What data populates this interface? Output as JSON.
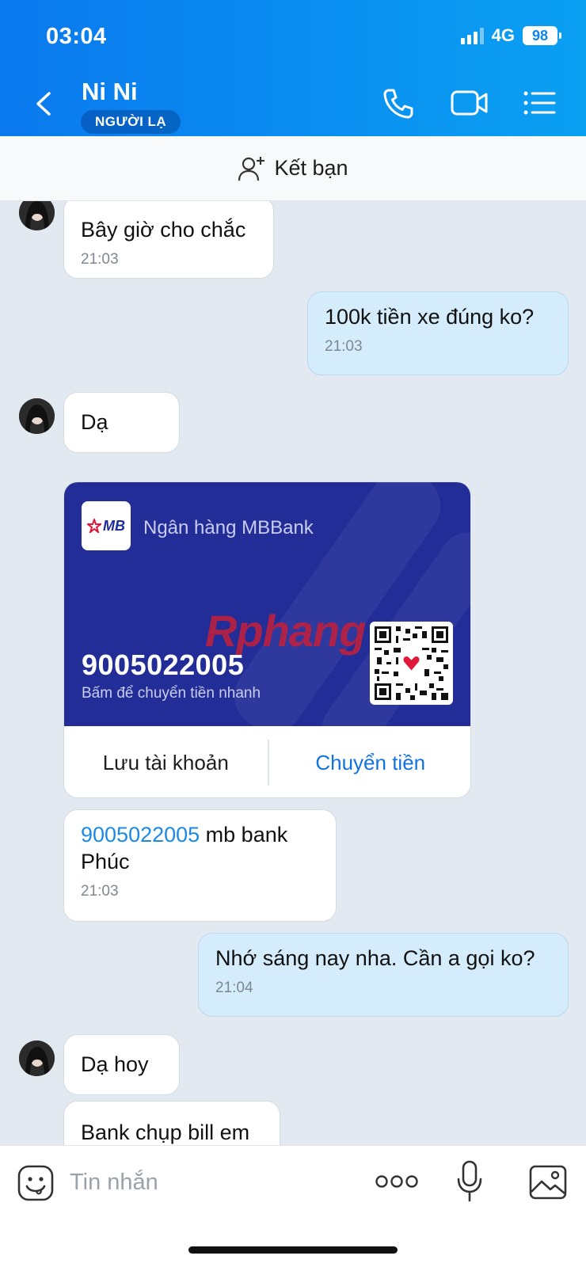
{
  "status_bar": {
    "time": "03:04",
    "network": "4G",
    "battery": "98"
  },
  "header": {
    "contact_name": "Ni Ni",
    "badge": "NGƯỜI LẠ"
  },
  "add_friend": {
    "label": "Kết bạn"
  },
  "messages": [
    {
      "side": "them",
      "text": "Bây giờ cho chắc",
      "time": "21:03"
    },
    {
      "side": "me",
      "text": "100k tiền xe đúng ko?",
      "time": "21:03"
    },
    {
      "side": "them",
      "text": "Dạ",
      "time": ""
    },
    {
      "side": "them",
      "text_link": "9005022005",
      "text_rest": " mb bank Phúc",
      "time": "21:03"
    },
    {
      "side": "me",
      "text": "Nhớ sáng nay nha. Cần a gọi ko?",
      "time": "21:04"
    },
    {
      "side": "them",
      "text": "Dạ hoy",
      "time": ""
    },
    {
      "side": "them",
      "text": "Bank chụp bill em",
      "time": ""
    }
  ],
  "bank_card": {
    "logo_text": "MB",
    "bank_name": "Ngân hàng MBBank",
    "watermark": "Rphang",
    "account_number": "9005022005",
    "hint": "Bấm để chuyển tiền nhanh",
    "save_label": "Lưu tài khoản",
    "transfer_label": "Chuyển tiền",
    "bg_color": "#232d97"
  },
  "composer": {
    "placeholder": "Tin nhắn"
  },
  "colors": {
    "header": "#0a86ef",
    "my_bubble": "#d4ecfb",
    "link": "#1b8ae5",
    "chat_bg": "#e2e9f1"
  },
  "icons": [
    "back-icon",
    "phone-icon",
    "video-call-icon",
    "menu-list-icon",
    "add-person-icon",
    "emoji-icon",
    "more-icon",
    "microphone-icon",
    "image-icon",
    "qr-code-icon"
  ]
}
